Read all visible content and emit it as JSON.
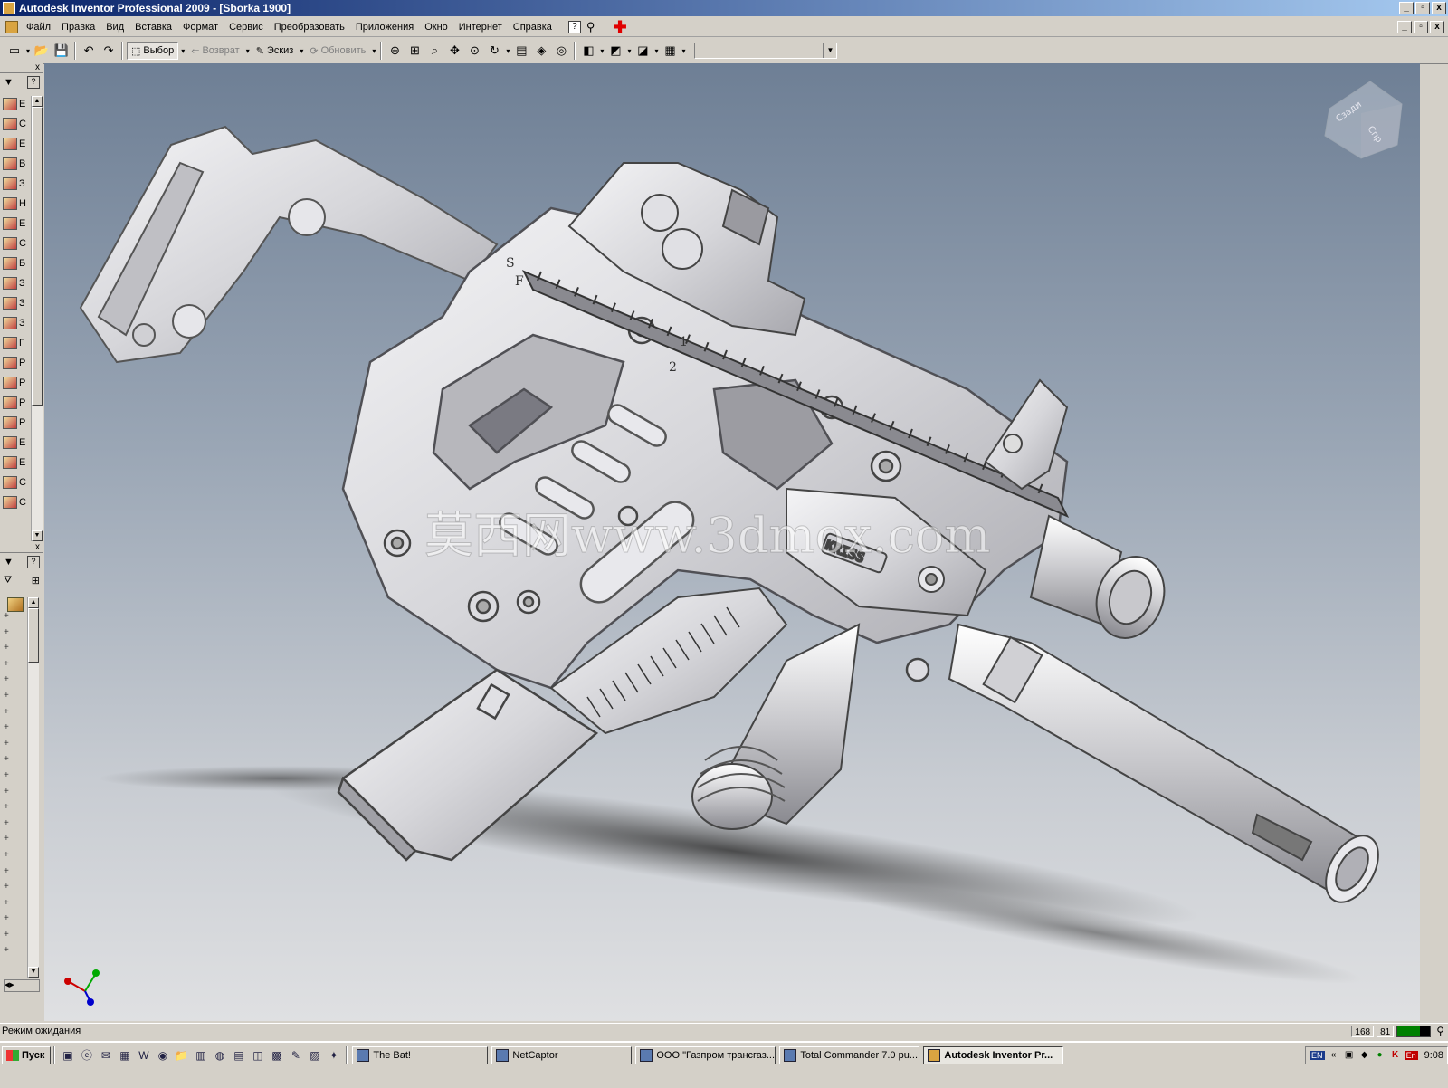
{
  "window": {
    "title": "Autodesk Inventor Professional 2009 - [Sborka 1900]",
    "controls": [
      "_",
      "▫",
      "x"
    ]
  },
  "menu": {
    "items": [
      "Файл",
      "Правка",
      "Вид",
      "Вставка",
      "Формат",
      "Сервис",
      "Преобразовать",
      "Приложения",
      "Окно",
      "Интернет",
      "Справка"
    ],
    "help_icon": "?",
    "mdi_controls": [
      "_",
      "▫",
      "x"
    ]
  },
  "toolbar": {
    "select_label": "Выбор",
    "return_label": "Возврат",
    "sketch_label": "Эскиз",
    "update_label": "Обновить",
    "combo_value": ""
  },
  "left_panel": {
    "help": "?",
    "close": "x",
    "tool_letters": [
      "Е",
      "С",
      "Е",
      "В",
      "З",
      "Н",
      "Е",
      "С",
      "Б",
      "З",
      "З",
      "З",
      "Г",
      "Р",
      "Р",
      "Р",
      "Р",
      "Е",
      "Е",
      "С",
      "С"
    ],
    "tree_expanders": [
      "+",
      "+",
      "+",
      "+",
      "+",
      "+",
      "+",
      "+",
      "+",
      "+",
      "+",
      "+",
      "+",
      "+",
      "+",
      "+",
      "+",
      "+",
      "+",
      "+",
      "+",
      "+"
    ]
  },
  "viewport": {
    "watermark": "莫西网www.3dmox.com",
    "viewcube_faces": [
      "Сзади",
      "Спр"
    ],
    "background_top": "#6e7f95",
    "background_bottom": "#dfe0e2",
    "part_color": "#d8d8dc",
    "marking_text": "KRISS",
    "selector_marks": [
      "S",
      "F",
      "1",
      "2"
    ]
  },
  "status": {
    "message": "Режим ожидания",
    "coord_a": "168",
    "coord_b": "81"
  },
  "taskbar": {
    "start_label": "Пуск",
    "tasks": [
      {
        "label": "The Bat!",
        "active": false
      },
      {
        "label": "NetCaptor",
        "active": false
      },
      {
        "label": "ООО \"Газпром трансгаз...",
        "active": false
      },
      {
        "label": "Total Commander 7.0 pu...",
        "active": false
      },
      {
        "label": "Autodesk Inventor Pr...",
        "active": true
      }
    ],
    "tray": {
      "lang1": "EN",
      "lang2": "En",
      "clock": "9:08"
    },
    "quicklaunch_icons": [
      "desktop-icon",
      "ie-icon",
      "outlook-icon",
      "excel-icon",
      "word-icon",
      "media-icon",
      "folder-icon",
      "chart-icon",
      "green-icon",
      "notepad-icon",
      "camera-icon",
      "save-icon",
      "paint-icon",
      "zip-icon",
      "tools-icon"
    ]
  }
}
